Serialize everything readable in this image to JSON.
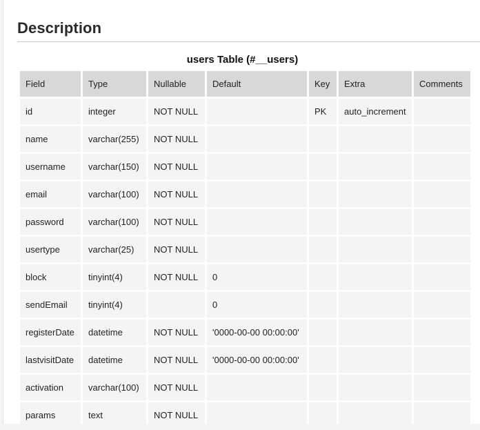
{
  "section": {
    "title": "Description"
  },
  "table": {
    "caption": "users Table (#__users)",
    "columns": [
      "Field",
      "Type",
      "Nullable",
      "Default",
      "Key",
      "Extra",
      "Comments"
    ],
    "rows": [
      [
        "id",
        "integer",
        "NOT NULL",
        "",
        "PK",
        "auto_increment",
        ""
      ],
      [
        "name",
        "varchar(255)",
        "NOT NULL",
        "",
        "",
        "",
        ""
      ],
      [
        "username",
        "varchar(150)",
        "NOT NULL",
        "",
        "",
        "",
        ""
      ],
      [
        "email",
        "varchar(100)",
        "NOT NULL",
        "",
        "",
        "",
        ""
      ],
      [
        "password",
        "varchar(100)",
        "NOT NULL",
        "",
        "",
        "",
        ""
      ],
      [
        "usertype",
        "varchar(25)",
        "NOT NULL",
        "",
        "",
        "",
        ""
      ],
      [
        "block",
        "tinyint(4)",
        "NOT NULL",
        "0",
        "",
        "",
        ""
      ],
      [
        "sendEmail",
        "tinyint(4)",
        "",
        "0",
        "",
        "",
        ""
      ],
      [
        "registerDate",
        "datetime",
        "NOT NULL",
        "'0000-00-00 00:00:00'",
        "",
        "",
        ""
      ],
      [
        "lastvisitDate",
        "datetime",
        "NOT NULL",
        "'0000-00-00 00:00:00'",
        "",
        "",
        ""
      ],
      [
        "activation",
        "varchar(100)",
        "NOT NULL",
        "",
        "",
        "",
        ""
      ],
      [
        "params",
        "text",
        "NOT NULL",
        "",
        "",
        "",
        ""
      ]
    ]
  }
}
